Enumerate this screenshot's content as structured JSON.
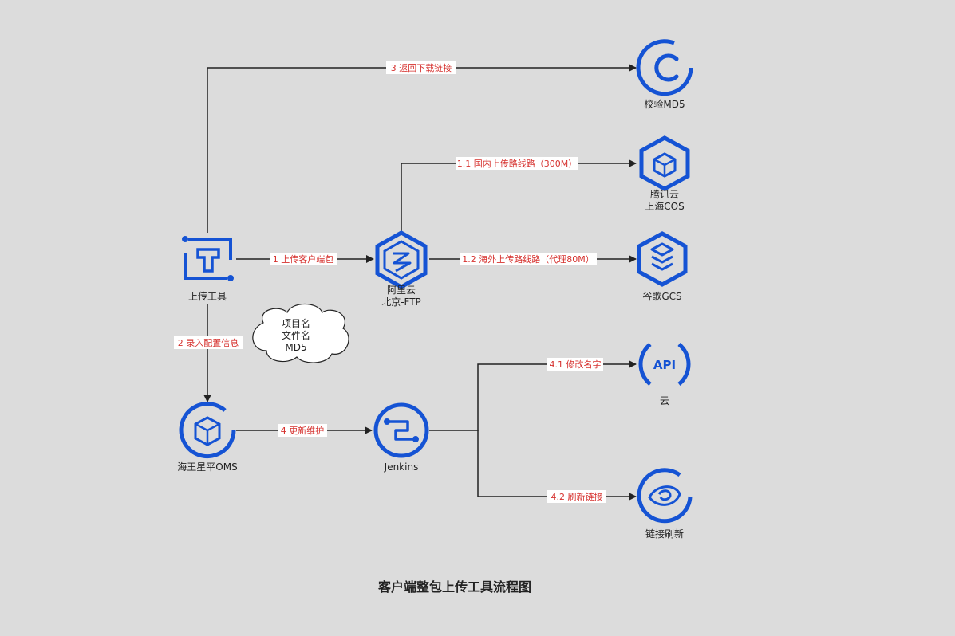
{
  "title": "客户端整包上传工具流程图",
  "colors": {
    "icon": "#1553d4",
    "edge_text": "#d6312e",
    "line": "#222222",
    "background": "#dcdcdc"
  },
  "nodes": {
    "upload_tool": {
      "label": "上传工具",
      "icon": "t-circuit-icon"
    },
    "aliyun": {
      "line1": "阿里云",
      "line2": "北京-FTP",
      "icon": "hexagon-s-icon"
    },
    "md5": {
      "label": "校验MD5",
      "icon": "c-circle-icon"
    },
    "tencent": {
      "line1": "腾讯云",
      "line2": "上海COS",
      "icon": "hexagon-cube-icon"
    },
    "google": {
      "label": "谷歌GCS",
      "icon": "hexagon-layers-icon"
    },
    "oms": {
      "label": "海王星平OMS",
      "icon": "circle-cube-icon"
    },
    "jenkins": {
      "label": "Jenkins",
      "icon": "circle-s-circuit-icon"
    },
    "cloud": {
      "label": "云",
      "icon": "api-icon"
    },
    "refresh": {
      "label": "链接刷新",
      "icon": "eye-swirl-icon"
    }
  },
  "edges": {
    "upload": "1 上传客户端包",
    "domestic": "1.1 国内上传路线路（300M）",
    "overseas": "1.2 海外上传路线路（代理80M）",
    "config": "2 录入配置信息",
    "return_link": "3 返回下载链接",
    "update": "4 更新维护",
    "rename": "4.1 修改名字",
    "refresh_link": "4.2 刷新链接"
  },
  "note": {
    "lines": [
      "项目名",
      "文件名",
      "MD5"
    ]
  }
}
